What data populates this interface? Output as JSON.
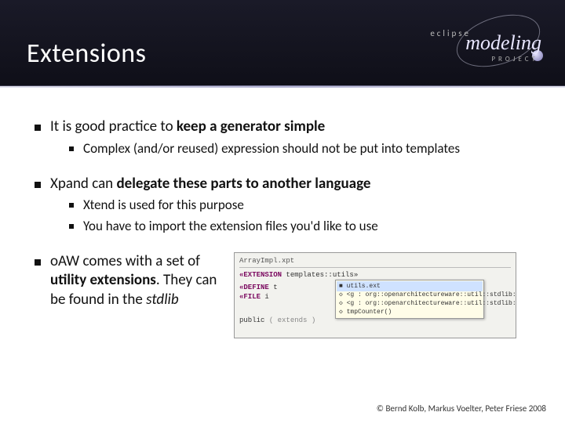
{
  "title": "Extensions",
  "logo": {
    "line1": "eclipse",
    "line2": "modeling",
    "line3": "PROJECT"
  },
  "bullets": {
    "b1": {
      "pre": "It is good practice to ",
      "strong": "keep a generator simple"
    },
    "b1a": "Complex (and/or reused) expression should not be put into templates",
    "b2": {
      "pre": "Xpand can ",
      "strong": "delegate these parts to another language"
    },
    "b2a": "Xtend is used for this purpose",
    "b2b": "You have to import the extension files you'd like to use",
    "b3": {
      "pre": "oAW comes with a set of ",
      "strong": "utility extensions",
      "post1": ". They can be found in the ",
      "em": "stdlib"
    }
  },
  "code": {
    "tab": "ArrayImpl.xpt",
    "ext_kw": "«EXTENSION",
    "ext_path": " templates::utils»",
    "def_kw": "«DEFINE",
    "file_kw": "  «FILE",
    "def_rest": " t",
    "file_rest": " i",
    "pub": "        public ",
    "ext2": "( extends )",
    "popup": {
      "r0": "■ utils.ext",
      "r1": "◇ <g : org::openarchitectureware::util::stdlib::io",
      "r2": "◇ <g : org::openarchitectureware::util::stdlib::naming",
      "r3": "◇ tmpCounter()"
    }
  },
  "footer": "© Bernd Kolb, Markus Voelter, Peter Friese 2008"
}
